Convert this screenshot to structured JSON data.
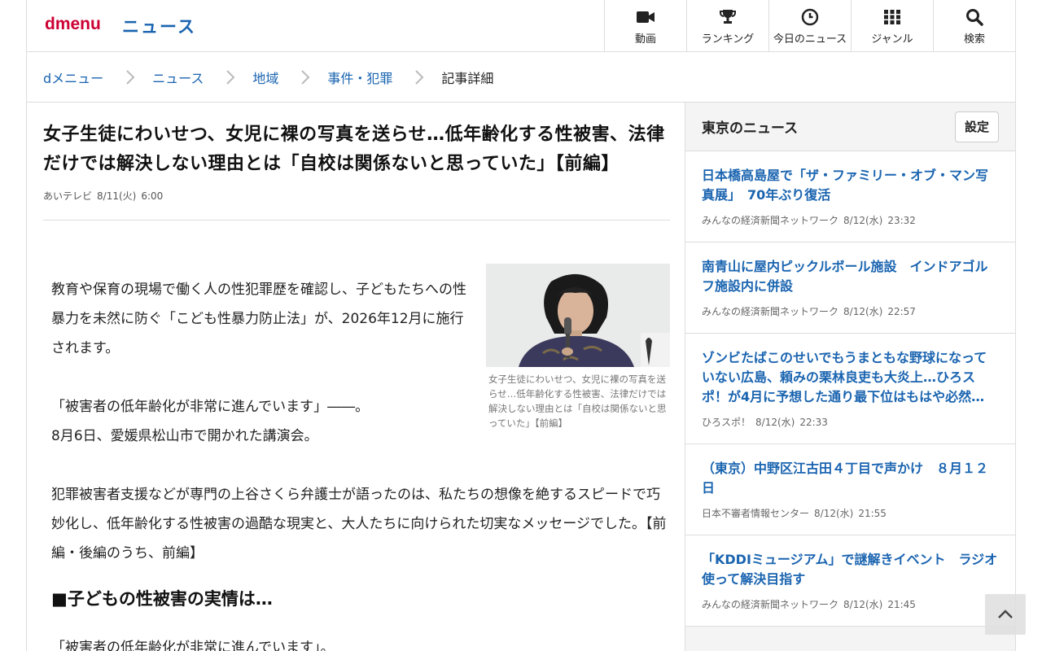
{
  "header": {
    "logo": "dmenu",
    "site_title": "ニュース",
    "nav": [
      {
        "label": "動画",
        "icon": "video-icon"
      },
      {
        "label": "ランキング",
        "icon": "trophy-icon"
      },
      {
        "label": "今日のニュース",
        "icon": "clock-icon"
      },
      {
        "label": "ジャンル",
        "icon": "grid-icon"
      },
      {
        "label": "検索",
        "icon": "search-icon"
      }
    ]
  },
  "breadcrumb": [
    "dメニュー",
    "ニュース",
    "地域",
    "事件・犯罪",
    "記事詳細"
  ],
  "article": {
    "headline": "女子生徒にわいせつ、女児に裸の写真を送らせ…低年齢化する性被害、法律だけでは解決しない理由とは「自校は関係ないと思っていた」【前編】",
    "source": "あいテレビ",
    "date": "8/11(火)",
    "time": "6:00",
    "photo_caption": "女子生徒にわいせつ、女児に裸の写真を送らせ…低年齢化する性被害、法律だけでは解決しない理由とは「自校は関係ないと思っていた」【前編】",
    "paragraphs": [
      "教育や保育の現場で働く人の性犯罪歴を確認し、子どもたちへの性暴力を未然に防ぐ「こども性暴力防止法」が、2026年12月に施行されます。",
      "「被害者の低年齢化が非常に進んでいます」――。",
      "8月6日、愛媛県松山市で開かれた講演会。",
      "犯罪被害者支援などが専門の上谷さくら弁護士が語ったのは、私たちの想像を絶するスピードで巧妙化し、低年齢化する性被害の過酷な現実と、大人たちに向けられた切実なメッセージでした。【前編・後編のうち、前編】"
    ],
    "subhead": "■子どもの性被害の実情は…",
    "last_line": "「被害者の低年齢化が非常に進んでいます」。"
  },
  "sidebar": {
    "title": "東京のニュース",
    "settings_label": "設定",
    "items": [
      {
        "title": "日本橋高島屋で「ザ・ファミリー・オブ・マン写真展」　70年ぶり復活",
        "source": "みんなの経済新聞ネットワーク",
        "date": "8/12(水)",
        "time": "23:32"
      },
      {
        "title": "南青山に屋内ピックルボール施設　インドアゴルフ施設内に併設",
        "source": "みんなの経済新聞ネットワーク",
        "date": "8/12(水)",
        "time": "22:57"
      },
      {
        "title": "ゾンビたばこのせいでもうまともな野球になっていない広島、頼みの栗林良吏も大炎上…ひろスポ！が4月に予想した通り最下位はもはや必然…",
        "source": "ひろスポ！",
        "date": "8/12(水)",
        "time": "22:33"
      },
      {
        "title": "（東京）中野区江古田４丁目で声かけ　８月１２日",
        "source": "日本不審者情報センター",
        "date": "8/12(水)",
        "time": "21:55"
      },
      {
        "title": "「KDDIミュージアム」で謎解きイベント　ラジオ使って解決目指す",
        "source": "みんなの経済新聞ネットワーク",
        "date": "8/12(水)",
        "time": "21:45"
      }
    ]
  },
  "colors": {
    "brand": "#cc0033",
    "link": "#1a64b0"
  }
}
